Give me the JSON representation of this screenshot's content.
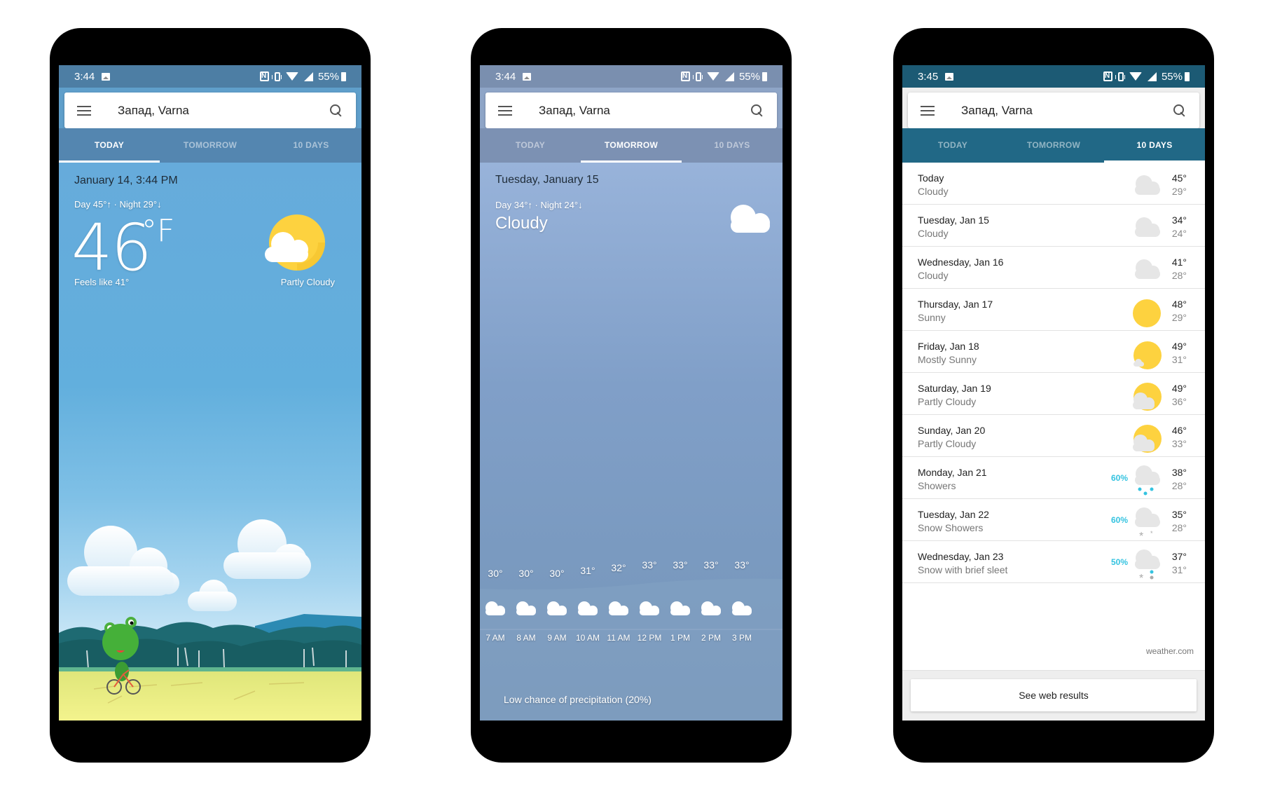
{
  "location": "Запад, Varna",
  "tabs": [
    "TODAY",
    "TOMORROW",
    "10 DAYS"
  ],
  "phones": [
    {
      "status": {
        "time": "3:44",
        "battery": "55%"
      },
      "active_tab": 0,
      "today": {
        "datetime": "January 14, 3:44 PM",
        "day_night": "Day 45°↑ · Night 29°↓",
        "temp": "46",
        "unit": "°F",
        "feels_like": "Feels like 41°",
        "condition": "Partly Cloudy",
        "icon": "partly-cloudy-icon"
      }
    },
    {
      "status": {
        "time": "3:44",
        "battery": "55%"
      },
      "active_tab": 1,
      "tomorrow": {
        "date": "Tuesday, January 15",
        "day_night": "Day 34°↑ · Night 24°↓",
        "condition": "Cloudy",
        "icon": "cloud-icon",
        "hourly": [
          {
            "temp": "30°",
            "time": "7 AM"
          },
          {
            "temp": "30°",
            "time": "8 AM"
          },
          {
            "temp": "30°",
            "time": "9 AM"
          },
          {
            "temp": "31°",
            "time": "10 AM"
          },
          {
            "temp": "32°",
            "time": "11 AM"
          },
          {
            "temp": "33°",
            "time": "12 PM"
          },
          {
            "temp": "33°",
            "time": "1 PM"
          },
          {
            "temp": "33°",
            "time": "2 PM"
          },
          {
            "temp": "33°",
            "time": "3 PM"
          }
        ],
        "precip_note": "Low chance of precipitation (20%)"
      }
    },
    {
      "status": {
        "time": "3:45",
        "battery": "55%"
      },
      "active_tab": 2,
      "ten_days": {
        "days": [
          {
            "name": "Today",
            "condition": "Cloudy",
            "hi": "45°",
            "lo": "29°",
            "precip": "",
            "icon": "cloudy"
          },
          {
            "name": "Tuesday, Jan 15",
            "condition": "Cloudy",
            "hi": "34°",
            "lo": "24°",
            "precip": "",
            "icon": "cloudy"
          },
          {
            "name": "Wednesday, Jan 16",
            "condition": "Cloudy",
            "hi": "41°",
            "lo": "28°",
            "precip": "",
            "icon": "cloudy"
          },
          {
            "name": "Thursday, Jan 17",
            "condition": "Sunny",
            "hi": "48°",
            "lo": "29°",
            "precip": "",
            "icon": "sunny"
          },
          {
            "name": "Friday, Jan 18",
            "condition": "Mostly Sunny",
            "hi": "49°",
            "lo": "31°",
            "precip": "",
            "icon": "mostly-sunny"
          },
          {
            "name": "Saturday, Jan 19",
            "condition": "Partly Cloudy",
            "hi": "49°",
            "lo": "36°",
            "precip": "",
            "icon": "partly-cloudy"
          },
          {
            "name": "Sunday, Jan 20",
            "condition": "Partly Cloudy",
            "hi": "46°",
            "lo": "33°",
            "precip": "",
            "icon": "partly-cloudy"
          },
          {
            "name": "Monday, Jan 21",
            "condition": "Showers",
            "hi": "38°",
            "lo": "28°",
            "precip": "60%",
            "icon": "showers"
          },
          {
            "name": "Tuesday, Jan 22",
            "condition": "Snow Showers",
            "hi": "35°",
            "lo": "28°",
            "precip": "60%",
            "icon": "snow-showers"
          },
          {
            "name": "Wednesday, Jan 23",
            "condition": "Snow with brief sleet",
            "hi": "37°",
            "lo": "31°",
            "precip": "50%",
            "icon": "snow-sleet"
          }
        ],
        "source": "weather.com",
        "web_button": "See web results"
      }
    }
  ],
  "colors": {
    "sun": "#fdd23f",
    "sun_shade": "#f4c12c",
    "cloud_light": "#e6e6e6",
    "precip_blue": "#34c3e0",
    "today_sky": "#62afdd",
    "tomorrow_sky": "#809fc8",
    "tenday_header": "#216886"
  }
}
